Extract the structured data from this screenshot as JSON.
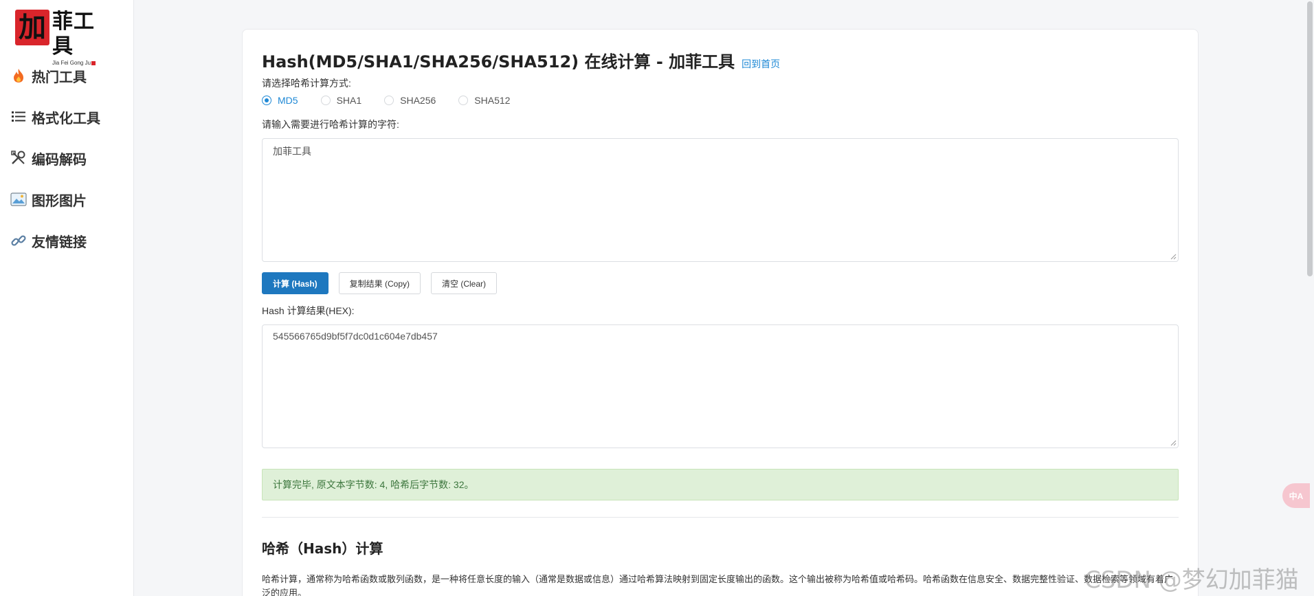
{
  "logo": {
    "mark": "加",
    "title": "菲工具",
    "subtitle": "Jia Fei Gong Ju"
  },
  "sidebar": {
    "items": [
      {
        "label": "热门工具",
        "icon": "fire-icon"
      },
      {
        "label": "格式化工具",
        "icon": "list-icon"
      },
      {
        "label": "编码解码",
        "icon": "tools-icon"
      },
      {
        "label": "图形图片",
        "icon": "image-icon"
      },
      {
        "label": "友情链接",
        "icon": "link-icon"
      }
    ]
  },
  "header": {
    "title": "Hash(MD5/SHA1/SHA256/SHA512) 在线计算 - 加菲工具",
    "home_link": "回到首页"
  },
  "form": {
    "method_label": "请选择哈希计算方式:",
    "methods": [
      "MD5",
      "SHA1",
      "SHA256",
      "SHA512"
    ],
    "selected_method": "MD5",
    "input_label": "请输入需要进行哈希计算的字符:",
    "input_value": "加菲工具",
    "buttons": {
      "hash": "计算 (Hash)",
      "copy": "复制结果 (Copy)",
      "clear": "清空 (Clear)"
    },
    "result_label": "Hash 计算结果(HEX):",
    "result_value": "545566765d9bf5f7dc0d1c604e7db457"
  },
  "status": {
    "message": "计算完毕, 原文本字节数: 4, 哈希后字节数: 32。"
  },
  "article": {
    "title": "哈希（Hash）计算",
    "paragraph": "哈希计算，通常称为哈希函数或散列函数，是一种将任意长度的输入（通常是数据或信息）通过哈希算法映射到固定长度输出的函数。这个输出被称为哈希值或哈希码。哈希函数在信息安全、数据完整性验证、数据检索等领域有着广泛的应用。"
  },
  "translate_button": "中A",
  "watermark": "CSDN @梦幻加菲猫",
  "colors": {
    "accent": "#1e88d5",
    "primary_button": "#1e78bf",
    "success_bg": "#dff0d8",
    "success_text": "#3c763d",
    "logo_red": "#d9252b"
  }
}
